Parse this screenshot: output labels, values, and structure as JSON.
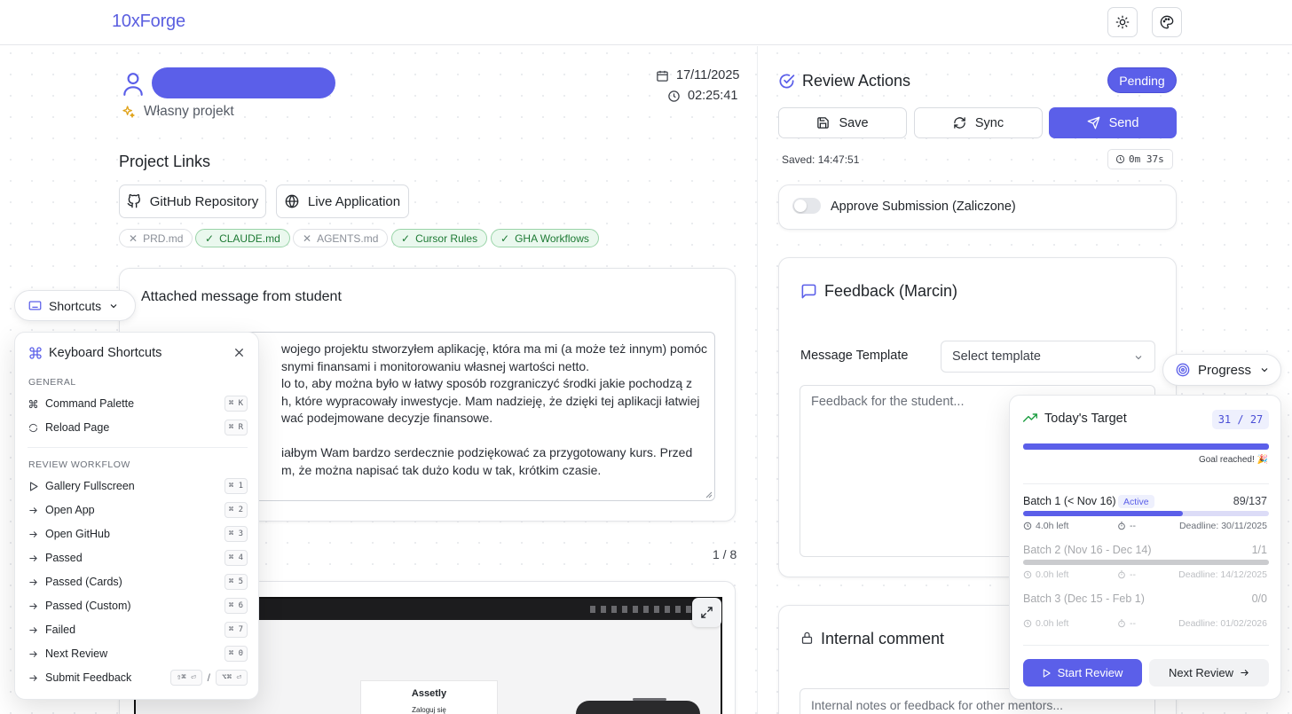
{
  "app": {
    "brand": "10xForge"
  },
  "header": {
    "theme_icon": "sun-icon",
    "palette_icon": "palette-icon"
  },
  "submission": {
    "project_type": "Własny projekt",
    "date": "17/11/2025",
    "time": "02:25:41"
  },
  "links": {
    "title": "Project Links",
    "github_label": "GitHub Repository",
    "live_label": "Live Application",
    "chips": [
      {
        "label": "PRD.md",
        "present": false
      },
      {
        "label": "CLAUDE.md",
        "present": true
      },
      {
        "label": "AGENTS.md",
        "present": false
      },
      {
        "label": "Cursor Rules",
        "present": true
      },
      {
        "label": "GHA Workflows",
        "present": true
      }
    ]
  },
  "message": {
    "title": "Attached message from student",
    "lines": [
      "wojego projektu stworzyłem aplikację, która ma mi (a może też innym) pomóc",
      "snymi finansami i monitorowaniu własnej wartości netto.",
      "lo to, aby można było w łatwy sposób rozgraniczyć środki jakie pochodzą z",
      "h, które wypracowały inwestycje. Mam nadzieję, że dzięki tej aplikacji łatwiej",
      "wać podejmowane decyzje finansowe.",
      "",
      "iałbym Wam bardzo serdecznie podziękować za przygotowany kurs. Przed",
      "m, że można napisać tak dużo kodu w tak, krótkim czasie."
    ]
  },
  "gallery": {
    "counter": "1 / 8",
    "preview_app_name": "Assetly",
    "preview_login": "Zaloguj się"
  },
  "shortcuts": {
    "toggle_label": "Shortcuts",
    "panel_title": "Keyboard Shortcuts",
    "general_title": "GENERAL",
    "general": [
      {
        "label": "Command Palette",
        "key": "⌘ K",
        "icon": "command-icon"
      },
      {
        "label": "Reload Page",
        "key": "⌘ R",
        "icon": "refresh-icon"
      }
    ],
    "workflow_title": "REVIEW WORKFLOW",
    "workflow": [
      {
        "label": "Gallery Fullscreen",
        "key": "⌘ 1",
        "icon": "play-icon"
      },
      {
        "label": "Open App",
        "key": "⌘ 2",
        "icon": "arrow-right-icon"
      },
      {
        "label": "Open GitHub",
        "key": "⌘ 3",
        "icon": "arrow-right-icon"
      },
      {
        "label": "Passed",
        "key": "⌘ 4",
        "icon": "arrow-right-icon"
      },
      {
        "label": "Passed (Cards)",
        "key": "⌘ 5",
        "icon": "arrow-right-icon"
      },
      {
        "label": "Passed (Custom)",
        "key": "⌘ 6",
        "icon": "arrow-right-icon"
      },
      {
        "label": "Failed",
        "key": "⌘ 7",
        "icon": "arrow-right-icon"
      },
      {
        "label": "Next Review",
        "key": "⌘ 0",
        "icon": "arrow-right-icon"
      },
      {
        "label": "Submit Feedback",
        "key": "⇧⌘ ⏎",
        "key_alt": "⌥⌘ ⏎",
        "separator": "/",
        "icon": "arrow-right-icon"
      }
    ]
  },
  "review": {
    "title": "Review Actions",
    "status": "Pending",
    "save_label": "Save",
    "sync_label": "Sync",
    "send_label": "Send",
    "saved_text": "Saved: 14:47:51",
    "timer": "0m 37s",
    "approve_label": "Approve Submission (Zaliczone)",
    "approve_on": false
  },
  "feedback": {
    "title": "Feedback (Marcin)",
    "template_label": "Message Template",
    "template_placeholder": "Select template",
    "textarea_placeholder": "Feedback for the student..."
  },
  "internal": {
    "title": "Internal comment",
    "textarea_placeholder": "Internal notes or feedback for other mentors..."
  },
  "progress": {
    "toggle_label": "Progress",
    "target_title": "Today's Target",
    "target_count": "31 / 27",
    "target_fraction": 1.0,
    "goal_text": "Goal reached! 🎉",
    "batches": [
      {
        "name": "Batch 1 (< Nov 16)",
        "badge": "Active",
        "count": "89/137",
        "fraction": 0.65,
        "time_left": "4.0h left",
        "eta": "--",
        "deadline": "Deadline: 30/11/2025"
      },
      {
        "name": "Batch 2 (Nov 16 - Dec 14)",
        "badge": "",
        "count": "1/1",
        "fraction": 1.0,
        "time_left": "0.0h left",
        "eta": "--",
        "deadline": "Deadline: 14/12/2025"
      },
      {
        "name": "Batch 3 (Dec 15 - Feb 1)",
        "badge": "",
        "count": "0/0",
        "fraction": 0,
        "time_left": "0.0h left",
        "eta": "--",
        "deadline": "Deadline: 01/02/2026"
      }
    ],
    "start_label": "Start Review",
    "next_label": "Next Review"
  }
}
